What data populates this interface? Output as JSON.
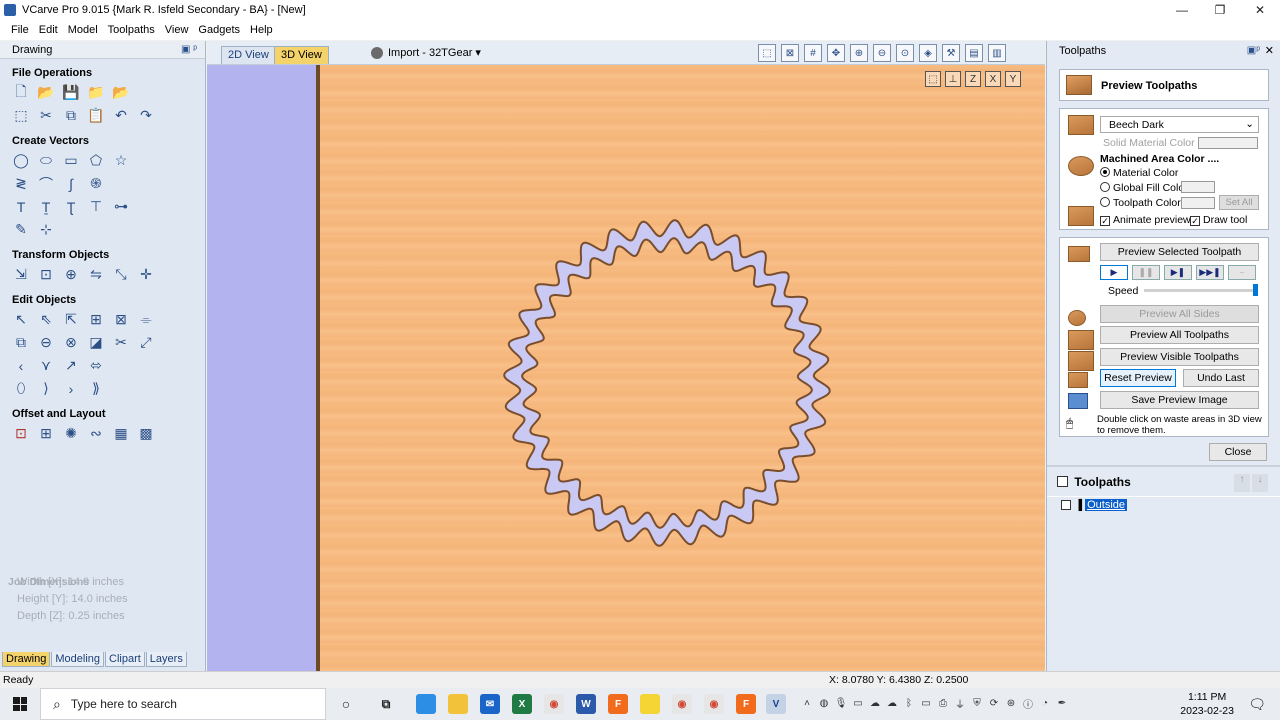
{
  "window": {
    "title": "VCarve Pro 9.015 {Mark R. Isfeld Secondary - BA} - [New]",
    "controls": [
      "—",
      "❐",
      "✕"
    ]
  },
  "menubar": {
    "items": [
      "File",
      "Edit",
      "Model",
      "Toolpaths",
      "View",
      "Gadgets",
      "Help"
    ],
    "mdi_controls": [
      "—",
      "❐",
      "✕"
    ]
  },
  "left_panel": {
    "header": "Drawing",
    "pin_icon": "pin-icon",
    "groups": [
      {
        "title": "File Operations"
      },
      {
        "title": "Create Vectors"
      },
      {
        "title": "Transform Objects"
      },
      {
        "title": "Edit Objects"
      },
      {
        "title": "Offset and Layout"
      }
    ],
    "job_dimensions": {
      "title": "Job Dimensions",
      "width": "Width  [X]: 14.0 inches",
      "height": "Height [Y]: 14.0 inches",
      "depth": "Depth  [Z]: 0.25 inches"
    },
    "tabs": [
      "Drawing",
      "Modeling",
      "Clipart",
      "Layers"
    ],
    "active_tab": "Drawing"
  },
  "view_bar": {
    "tab_2d": "2D View",
    "tab_3d": "3D View",
    "import_label": "Import - 32TGear ▾"
  },
  "right_panel": {
    "header": "Toolpaths",
    "preview_title": "Preview Toolpaths",
    "material": "Beech Dark",
    "solid_material_color": "Solid Material Color",
    "machined_area_color": "Machined Area Color ....",
    "radio_material_color": "Material Color",
    "radio_global_fill": "Global Fill Color",
    "radio_toolpath_color": "Toolpath Color",
    "set_all": "Set All",
    "animate_preview": "Animate preview",
    "draw_tool": "Draw tool",
    "preview_selected": "Preview Selected Toolpath",
    "speed_label": "Speed",
    "speed_level": 1.0,
    "preview_all_sides": "Preview All Sides",
    "preview_all_toolpaths": "Preview All Toolpaths",
    "preview_visible_toolpaths": "Preview Visible Toolpaths",
    "reset_preview": "Reset Preview",
    "undo_last": "Undo Last",
    "save_preview_image": "Save Preview Image",
    "hint": "Double click on waste areas in 3D view to remove them.",
    "close": "Close",
    "toolpaths_list_title": "Toolpaths",
    "toolpath_items": [
      "Outside"
    ]
  },
  "status_bar": {
    "status": "Ready",
    "coords": "X: 8.0780 Y: 6.4380 Z: 0.2500"
  },
  "taskbar": {
    "search_placeholder": "Type here to search",
    "time": "1:11 PM",
    "date": "2023-02-23"
  },
  "colors": {
    "wood": "#f6b97e",
    "background_strip": "#b3b3f0",
    "gear_fill": "#c9c9f3",
    "active_tab": "#f4d36a"
  }
}
